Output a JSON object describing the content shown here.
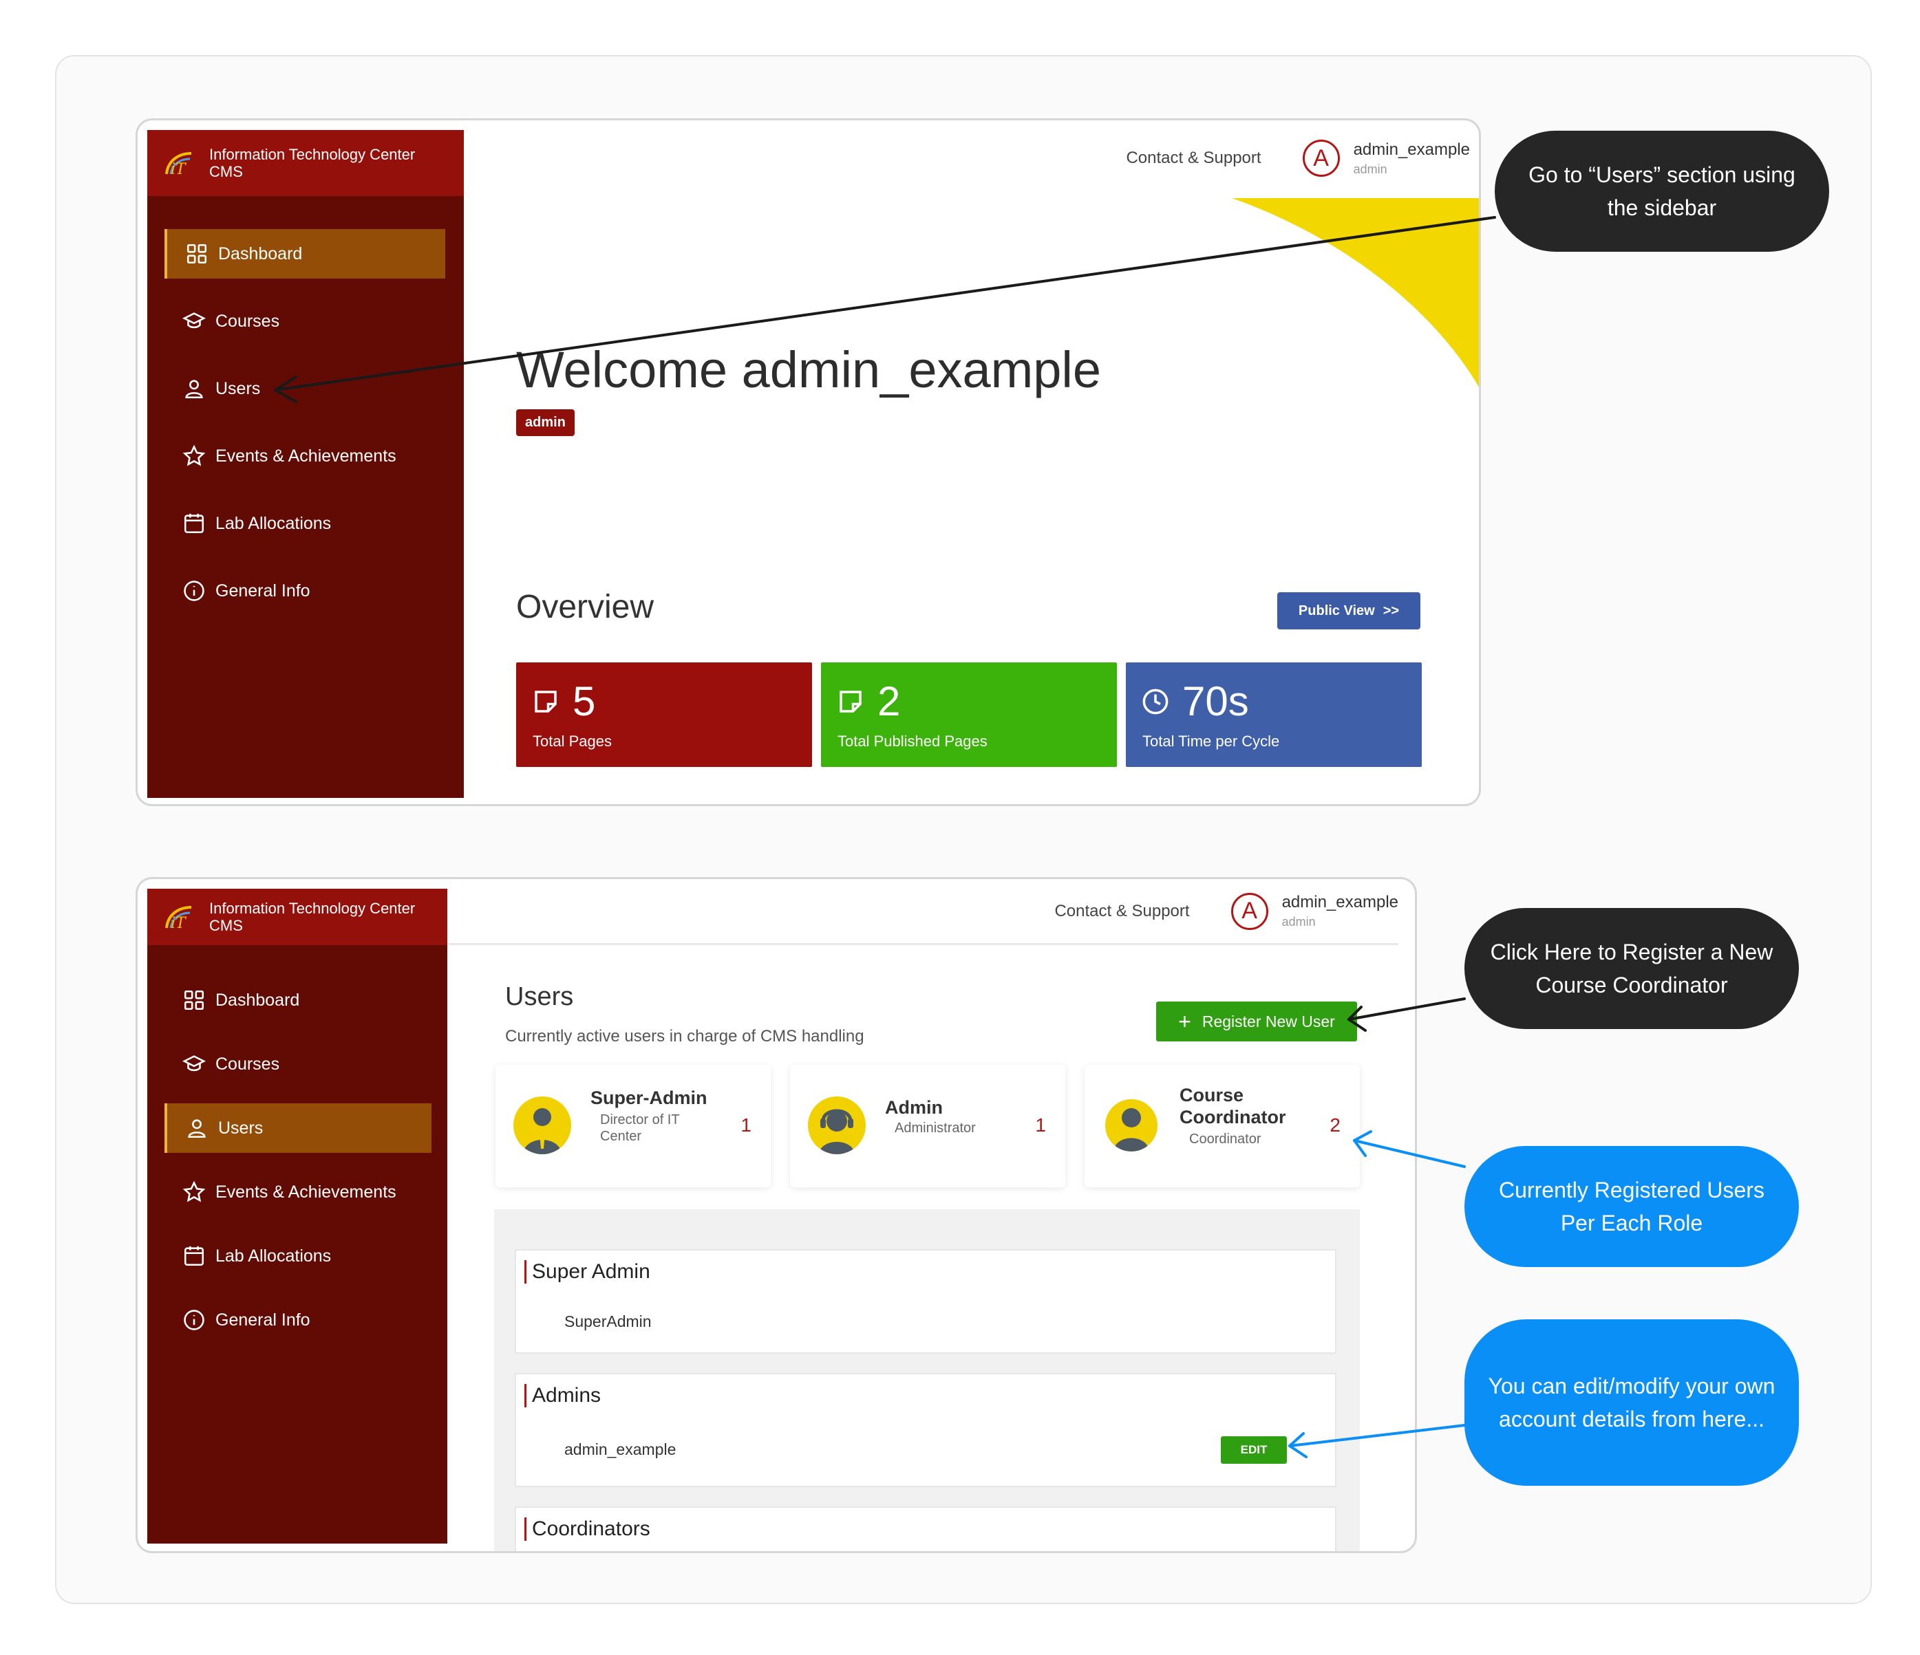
{
  "brand": {
    "name_line1": "Information Technology Center",
    "name_line2": "CMS"
  },
  "topbar": {
    "contact": "Contact & Support",
    "user_initial": "A",
    "username": "admin_example",
    "role": "admin"
  },
  "sidebar": {
    "items": [
      {
        "label": "Dashboard",
        "icon": "grid-icon"
      },
      {
        "label": "Courses",
        "icon": "graduation-cap-icon"
      },
      {
        "label": "Users",
        "icon": "user-icon"
      },
      {
        "label": "Events & Achievements",
        "icon": "star-icon"
      },
      {
        "label": "Lab Allocations",
        "icon": "calendar-icon"
      },
      {
        "label": "General Info",
        "icon": "info-icon"
      }
    ]
  },
  "dashboard": {
    "welcome": "Welcome admin_example",
    "badge": "admin",
    "overview_title": "Overview",
    "public_view": "Public View",
    "public_view_arrow": ">>",
    "stats": [
      {
        "value": "5",
        "label": "Total Pages",
        "color": "#9a0f0b",
        "icon": "page-icon"
      },
      {
        "value": "2",
        "label": "Total Published Pages",
        "color": "#3bb30b",
        "icon": "page-icon"
      },
      {
        "value": "70s",
        "label": "Total Time per Cycle",
        "color": "#3f5fa8",
        "icon": "clock-icon"
      }
    ]
  },
  "users_page": {
    "title": "Users",
    "subtitle": "Currently active users in charge of CMS handling",
    "register_button": "Register New User",
    "register_icon": "plus-icon",
    "roles": [
      {
        "title": "Super-Admin",
        "subtitle_line1": "Director of IT",
        "subtitle_line2": "Center",
        "count": "1",
        "icon": "businessman-icon"
      },
      {
        "title": "Admin",
        "subtitle_line1": "Administrator",
        "count": "1",
        "icon": "headset-icon"
      },
      {
        "title_line1": "Course",
        "title_line2": "Coordinator",
        "subtitle_line1": "Coordinator",
        "count": "2",
        "icon": "person-icon"
      }
    ],
    "groups": {
      "super_admin": {
        "title": "Super Admin",
        "members": [
          "SuperAdmin"
        ]
      },
      "admins": {
        "title": "Admins",
        "members": [
          "admin_example"
        ],
        "edit_label": "EDIT"
      },
      "coordinators": {
        "title": "Coordinators"
      }
    }
  },
  "callouts": {
    "users_section": "Go to “Users” section using the sidebar",
    "register": "Click Here to Register a New Course Coordinator",
    "registered_per_role": "Currently Registered Users Per Each Role",
    "edit_account": "You can edit/modify your own account details from here..."
  },
  "colors": {
    "brand_red": "#94110b",
    "sidebar_dark": "#620b05",
    "active_item": "#944d06",
    "accent_yellow": "#f2d800",
    "callout_dark": "#262626",
    "callout_blue": "#0a8ff7"
  }
}
